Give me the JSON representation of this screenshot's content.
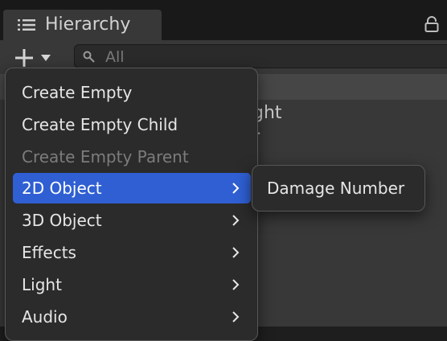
{
  "window": {
    "tab_title": "Hierarchy",
    "tab_icon": "list-icon",
    "lock_icon": "lock-icon"
  },
  "toolbar": {
    "create_icon": "plus-icon",
    "dropdown_icon": "caret-down-icon",
    "search": {
      "icon": "search-icon",
      "placeholder": "All",
      "value": ""
    }
  },
  "hierarchy": {
    "visible_fragments": [
      "ght",
      "r"
    ]
  },
  "context_menu": {
    "items": [
      {
        "label": "Create Empty",
        "enabled": true,
        "submenu": false
      },
      {
        "label": "Create Empty Child",
        "enabled": true,
        "submenu": false
      },
      {
        "label": "Create Empty Parent",
        "enabled": false,
        "submenu": false
      },
      {
        "label": "2D Object",
        "enabled": true,
        "submenu": true,
        "highlighted": true
      },
      {
        "label": "3D Object",
        "enabled": true,
        "submenu": true
      },
      {
        "label": "Effects",
        "enabled": true,
        "submenu": true
      },
      {
        "label": "Light",
        "enabled": true,
        "submenu": true
      },
      {
        "label": "Audio",
        "enabled": true,
        "submenu": true
      }
    ],
    "submenu_icon": "chevron-right-icon"
  },
  "submenu": {
    "items": [
      {
        "label": "Damage Number"
      }
    ]
  },
  "colors": {
    "highlight": "#2f5fd2",
    "panel": "#383838",
    "menu_bg": "#2b2b2b"
  }
}
